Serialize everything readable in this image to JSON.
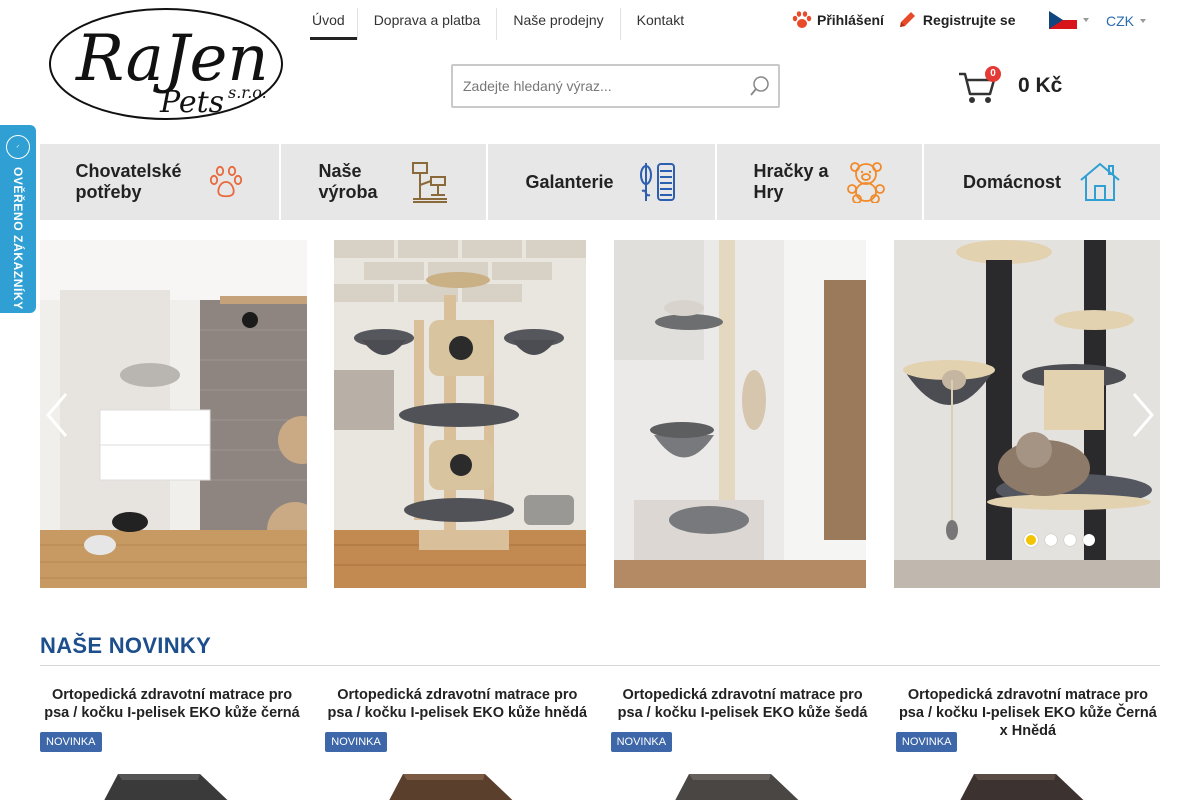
{
  "brand": {
    "logo_main": "RaJen",
    "logo_sub": "Pets",
    "logo_suffix": "s.r.o."
  },
  "topnav": [
    {
      "label": "Úvod",
      "active": true
    },
    {
      "label": "Doprava a platba",
      "active": false
    },
    {
      "label": "Naše prodejny",
      "active": false
    },
    {
      "label": "Kontakt",
      "active": false
    }
  ],
  "user": {
    "login": "Přihlášení",
    "register": "Registrujte se"
  },
  "locale": {
    "language_icon": "czech-flag",
    "currency": "CZK"
  },
  "search": {
    "placeholder": "Zadejte hledaný výraz..."
  },
  "cart": {
    "count": "0",
    "total": "0 Kč"
  },
  "verified_badge": {
    "text": "OVĚŘENO ZÁKAZNÍKY"
  },
  "categories": [
    {
      "label": "Chovatelské potřeby",
      "icon": "paw-icon",
      "color": "#e8693c"
    },
    {
      "label": "Naše výroba",
      "icon": "cat-tree-icon",
      "color": "#8a6a3a"
    },
    {
      "label": "Galanterie",
      "icon": "thread-spool-icon",
      "color": "#2c5fb0"
    },
    {
      "label": "Hračky a Hry",
      "icon": "teddy-bear-icon",
      "color": "#f08a2a"
    },
    {
      "label": "Domácnost",
      "icon": "house-icon",
      "color": "#2f9fd4"
    }
  ],
  "slider": {
    "slide_count": 4,
    "active_slide": 1
  },
  "section": {
    "title": "NAŠE NOVINKY"
  },
  "products": [
    {
      "title": "Ortopedická zdravotní matrace pro psa / kočku I-pelisek EKO kůže černá",
      "tag": "NOVINKA",
      "color": "#3a3a3a"
    },
    {
      "title": "Ortopedická zdravotní matrace pro psa / kočku I-pelisek EKO kůže hnědá",
      "tag": "NOVINKA",
      "color": "#5a3f2c"
    },
    {
      "title": "Ortopedická zdravotní matrace pro psa / kočku I-pelisek EKO kůže šedá",
      "tag": "NOVINKA",
      "color": "#4a4643"
    },
    {
      "title": "Ortopedická zdravotní matrace pro psa / kočku I-pelisek EKO kůže Černá x Hnědá",
      "tag": "NOVINKA",
      "color": "#3c3230"
    }
  ],
  "colors": {
    "accent_blue": "#1d4f8c",
    "badge_red": "#e53935",
    "verified_blue": "#2f9fd4",
    "dot_active": "#f3c404",
    "category_bg": "#e7e7e7",
    "tag_bg": "#3d67a8"
  }
}
